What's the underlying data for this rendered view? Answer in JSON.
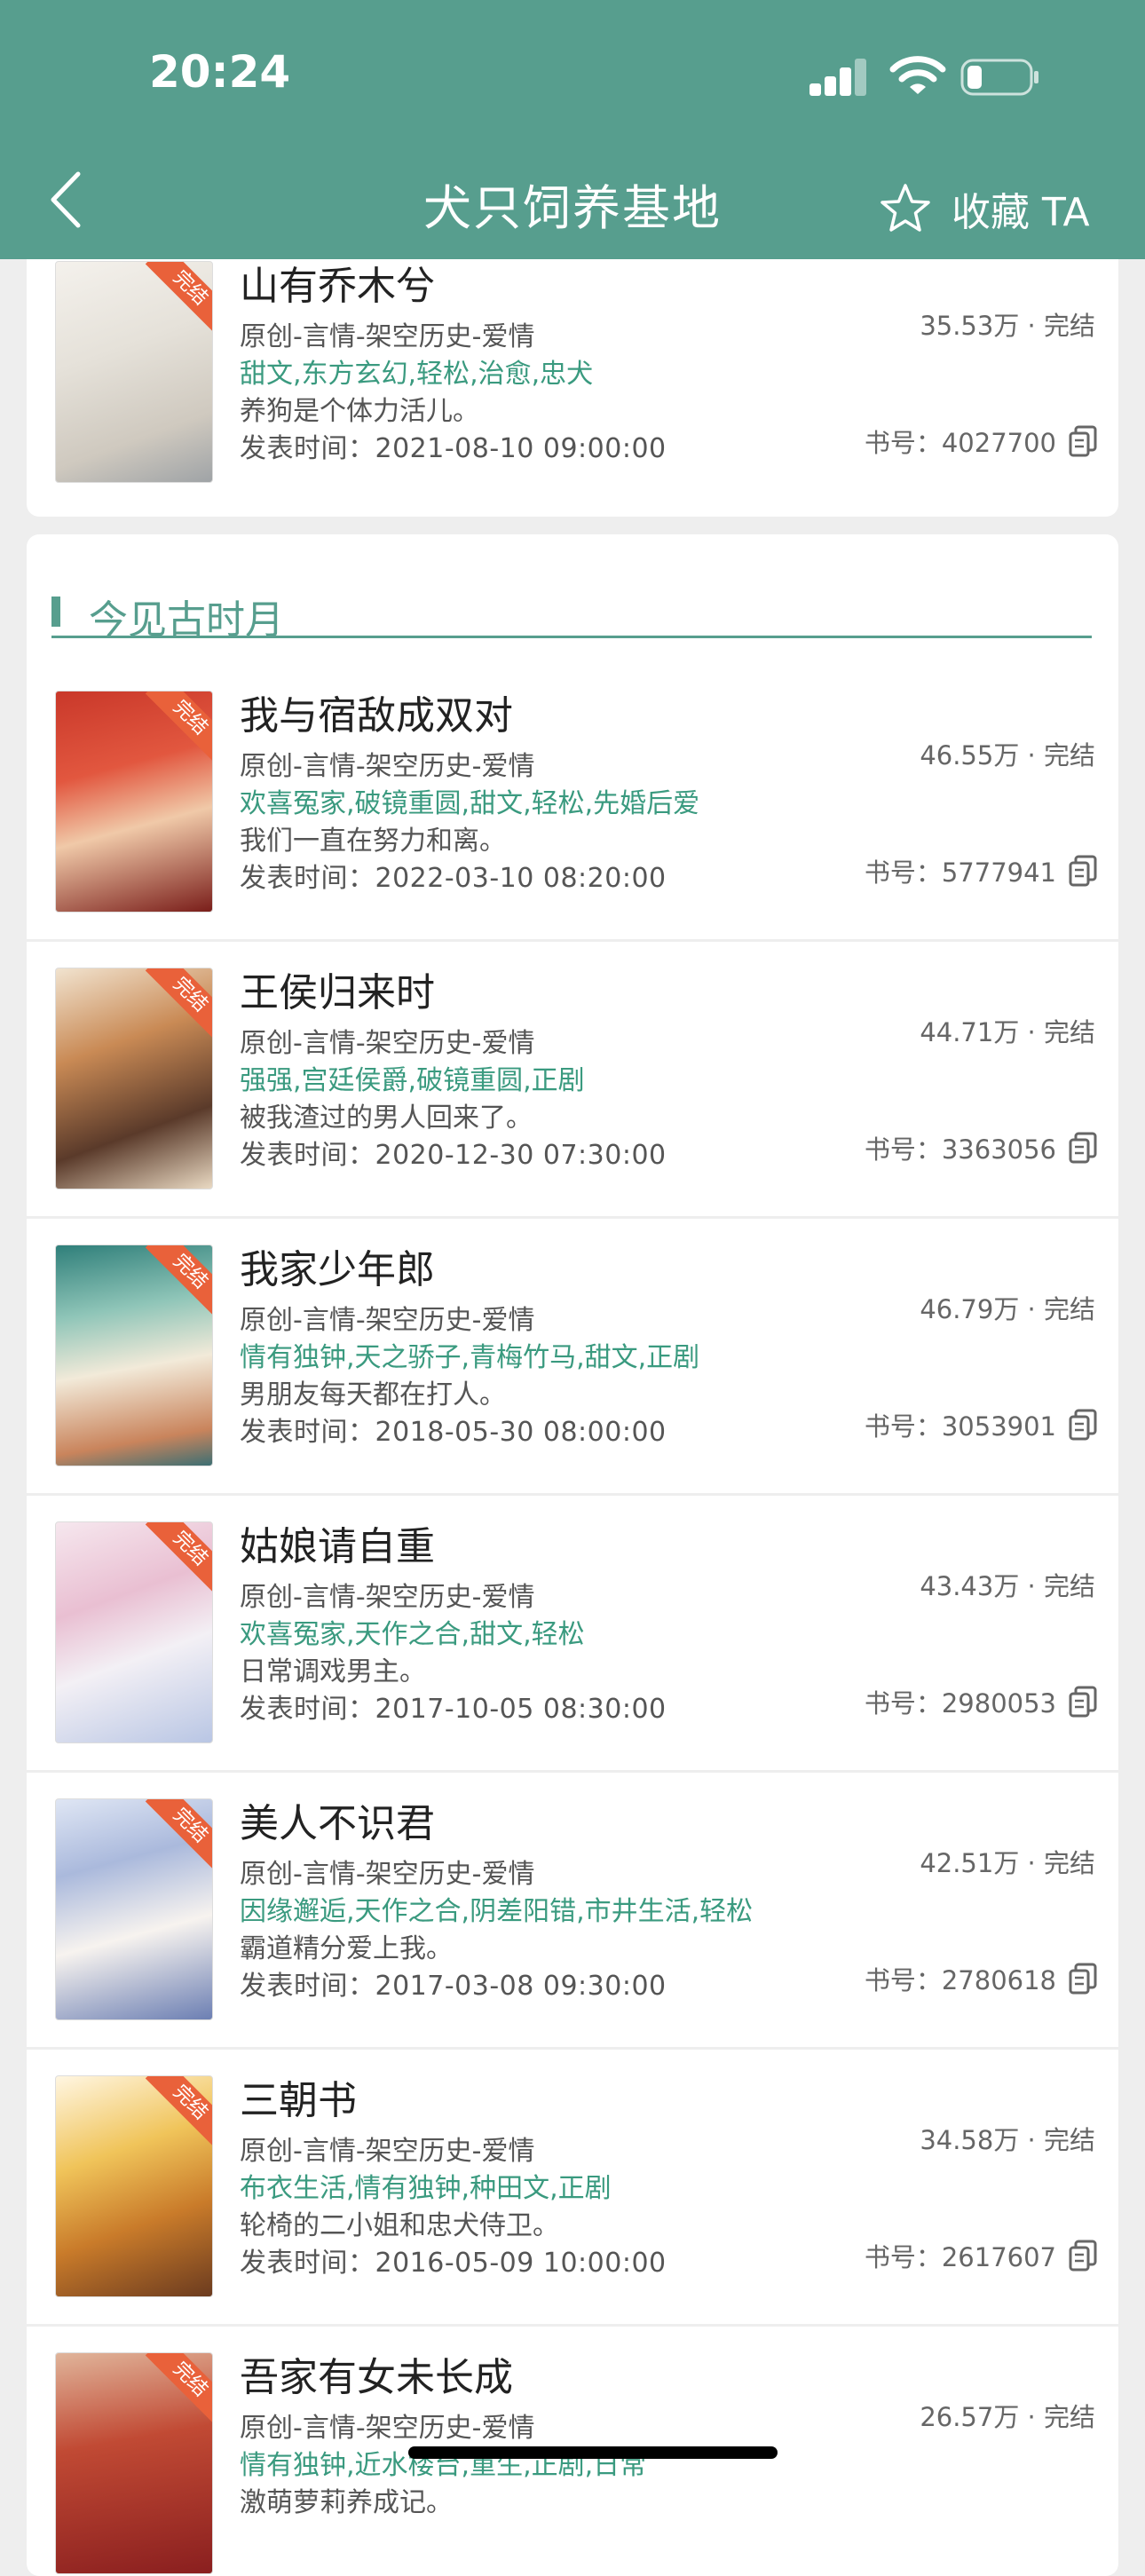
{
  "status_bar": {
    "time": "20:24"
  },
  "header": {
    "title": "犬只饲养基地",
    "favorite_label": "收藏 TA"
  },
  "top_book": {
    "title": "山有乔木兮",
    "category": "原创-言情-架空历史-爱情",
    "tags": "甜文,东方玄幻,轻松,治愈,忠犬",
    "desc": "养狗是个体力活儿。",
    "date": "发表时间：2021-08-10 09:00:00",
    "count": "35.53万 · 完结",
    "id": "书号：4027700"
  },
  "section": {
    "title": "今见古时月",
    "books": [
      {
        "title": "我与宿敌成双对",
        "category": "原创-言情-架空历史-爱情",
        "tags": "欢喜冤家,破镜重圆,甜文,轻松,先婚后爱",
        "desc": "我们一直在努力和离。",
        "date": "发表时间：2022-03-10 08:20:00",
        "count": "46.55万 · 完结",
        "id": "书号：5777941",
        "ribbon": "完结"
      },
      {
        "title": "王侯归来时",
        "category": "原创-言情-架空历史-爱情",
        "tags": "强强,宫廷侯爵,破镜重圆,正剧",
        "desc": "被我渣过的男人回来了。",
        "date": "发表时间：2020-12-30 07:30:00",
        "count": "44.71万 · 完结",
        "id": "书号：3363056",
        "ribbon": "完结"
      },
      {
        "title": "我家少年郎",
        "category": "原创-言情-架空历史-爱情",
        "tags": "情有独钟,天之骄子,青梅竹马,甜文,正剧",
        "desc": "男朋友每天都在打人。",
        "date": "发表时间：2018-05-30 08:00:00",
        "count": "46.79万 · 完结",
        "id": "书号：3053901",
        "ribbon": "完结"
      },
      {
        "title": "姑娘请自重",
        "category": "原创-言情-架空历史-爱情",
        "tags": "欢喜冤家,天作之合,甜文,轻松",
        "desc": "日常调戏男主。",
        "date": "发表时间：2017-10-05 08:30:00",
        "count": "43.43万 · 完结",
        "id": "书号：2980053",
        "ribbon": "完结"
      },
      {
        "title": "美人不识君",
        "category": "原创-言情-架空历史-爱情",
        "tags": "因缘邂逅,天作之合,阴差阳错,市井生活,轻松",
        "desc": "霸道精分爱上我。",
        "date": "发表时间：2017-03-08 09:30:00",
        "count": "42.51万 · 完结",
        "id": "书号：2780618",
        "ribbon": "完结"
      },
      {
        "title": "三朝书",
        "category": "原创-言情-架空历史-爱情",
        "tags": "布衣生活,情有独钟,种田文,正剧",
        "desc": "轮椅的二小姐和忠犬侍卫。",
        "date": "发表时间：2016-05-09 10:00:00",
        "count": "34.58万 · 完结",
        "id": "书号：2617607",
        "ribbon": "完结"
      },
      {
        "title": "吾家有女未长成",
        "category": "原创-言情-架空历史-爱情",
        "tags": "情有独钟,近水楼台,重生,正剧,日常",
        "desc": "激萌萝莉养成记。",
        "date": "",
        "count": "26.57万 · 完结",
        "id": "",
        "ribbon": "完结"
      }
    ]
  },
  "colors": {
    "accent": "#579e8e",
    "tag": "#3a9a7f",
    "ribbon": "#e9613a"
  }
}
